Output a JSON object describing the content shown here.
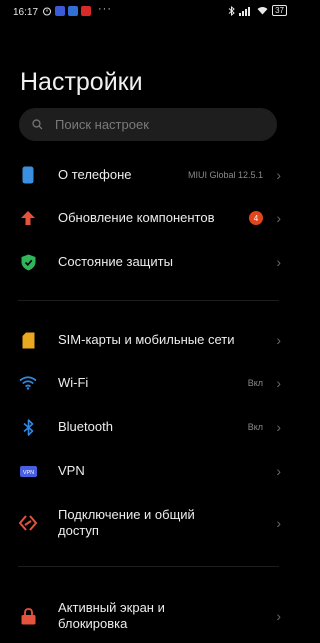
{
  "status_bar": {
    "time": "16:17",
    "dots": "···",
    "battery": "37"
  },
  "title": "Настройки",
  "search": {
    "placeholder": "Поиск настроек"
  },
  "rows": [
    {
      "label": "О телефоне",
      "value": "MIUI Global 12.5.1",
      "icon": "phone-icon",
      "color": "#3b8fe0"
    },
    {
      "label": "Обновление компонентов",
      "badge": "4",
      "icon": "arrow-up-icon",
      "color": "#e5533d"
    },
    {
      "label": "Состояние защиты",
      "icon": "shield-check-icon",
      "color": "#2fb55a"
    },
    {
      "label": "SIM-карты и мобильные сети",
      "icon": "sim-card-icon",
      "color": "#e8a820"
    },
    {
      "label": "Wi-Fi",
      "value": "Вкл",
      "icon": "wifi-icon",
      "color": "#2f87e0"
    },
    {
      "label": "Bluetooth",
      "value": "Вкл",
      "icon": "bluetooth-icon",
      "color": "#2f87e0"
    },
    {
      "label": "VPN",
      "icon": "vpn-icon",
      "color": "#4a5fe0"
    },
    {
      "label_line1": "Подключение и общий",
      "label_line2": "доступ",
      "icon": "share-connection-icon",
      "color": "#e5533d"
    },
    {
      "label_line1": "Активный экран и",
      "label_line2": "блокировка",
      "icon": "lock-icon",
      "color": "#e5533d"
    }
  ]
}
